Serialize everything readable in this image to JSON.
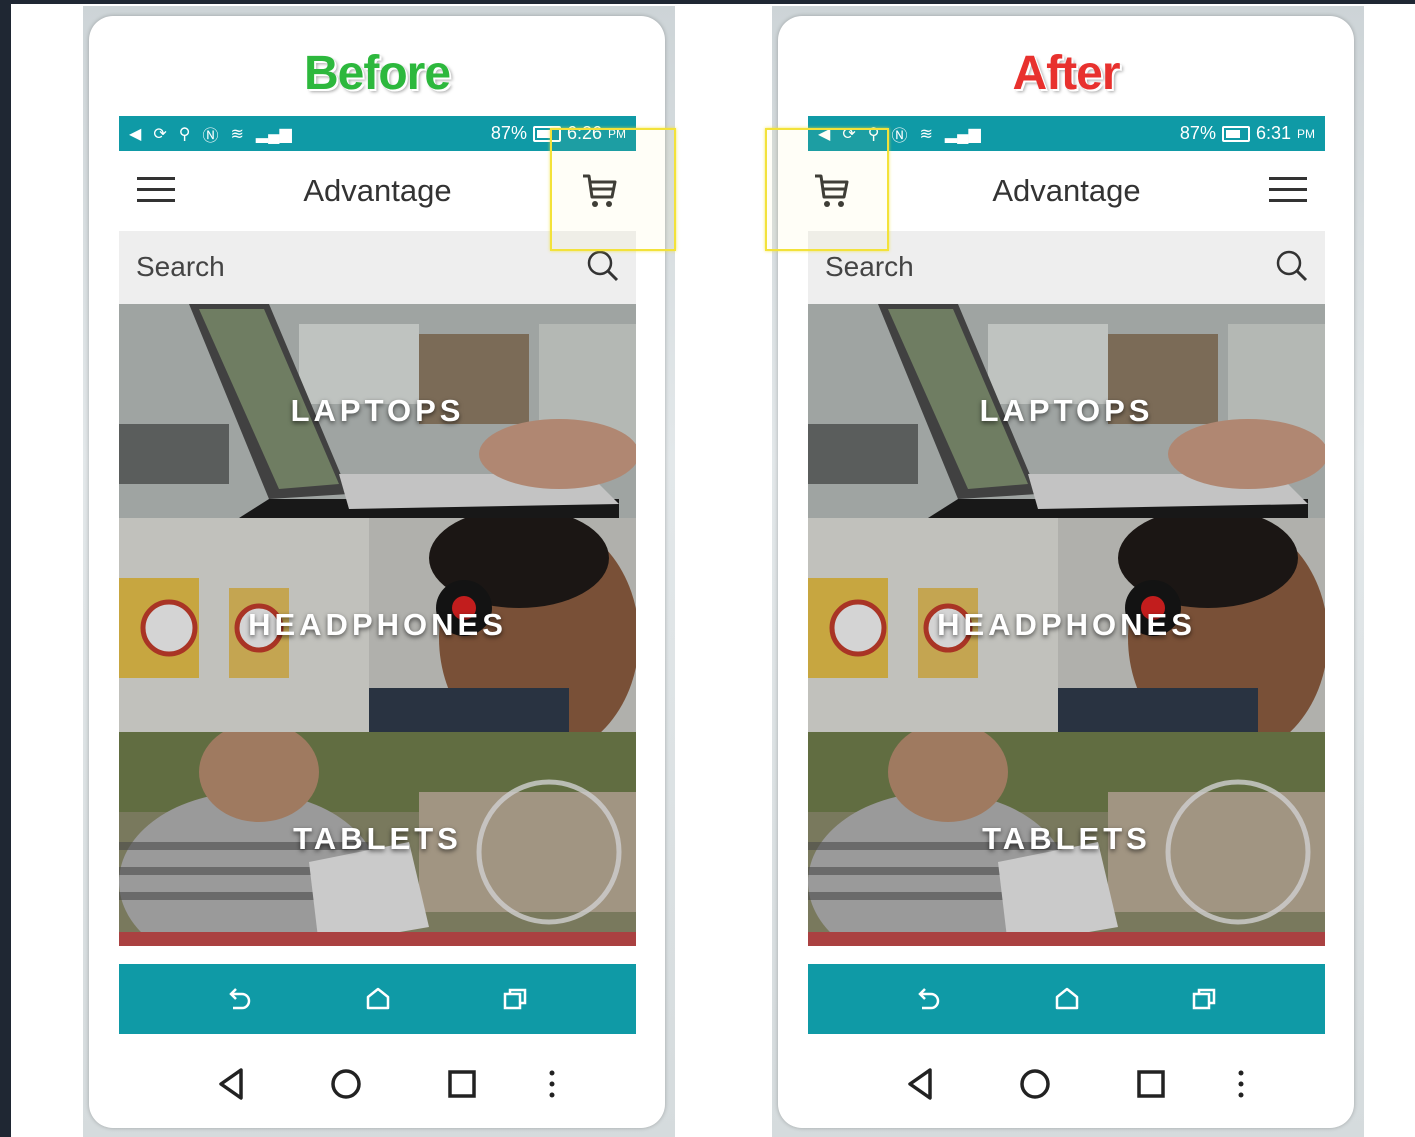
{
  "panels": [
    {
      "heading": "Before",
      "heading_color": "#2db83d",
      "status": {
        "battery": "87%",
        "time": "6:26",
        "ampm": "PM"
      },
      "app": {
        "title": "Advantage",
        "cart_position": "right",
        "menu_position": "left"
      },
      "search": {
        "placeholder": "Search"
      },
      "categories": [
        {
          "label": "LAPTOPS"
        },
        {
          "label": "HEADPHONES"
        },
        {
          "label": "TABLETS"
        }
      ]
    },
    {
      "heading": "After",
      "heading_color": "#e8312e",
      "status": {
        "battery": "87%",
        "time": "6:31",
        "ampm": "PM"
      },
      "app": {
        "title": "Advantage",
        "cart_position": "left",
        "menu_position": "right"
      },
      "search": {
        "placeholder": "Search"
      },
      "categories": [
        {
          "label": "LAPTOPS"
        },
        {
          "label": "HEADPHONES"
        },
        {
          "label": "TABLETS"
        }
      ]
    }
  ],
  "colors": {
    "accent": "#0f9aa6",
    "highlight": "#f3e23a"
  },
  "icons": [
    "cart-icon",
    "menu-icon",
    "search-icon",
    "back-icon",
    "home-icon",
    "recent-apps-icon",
    "triangle-back-icon",
    "circle-home-icon",
    "square-overview-icon",
    "overflow-menu-icon"
  ]
}
